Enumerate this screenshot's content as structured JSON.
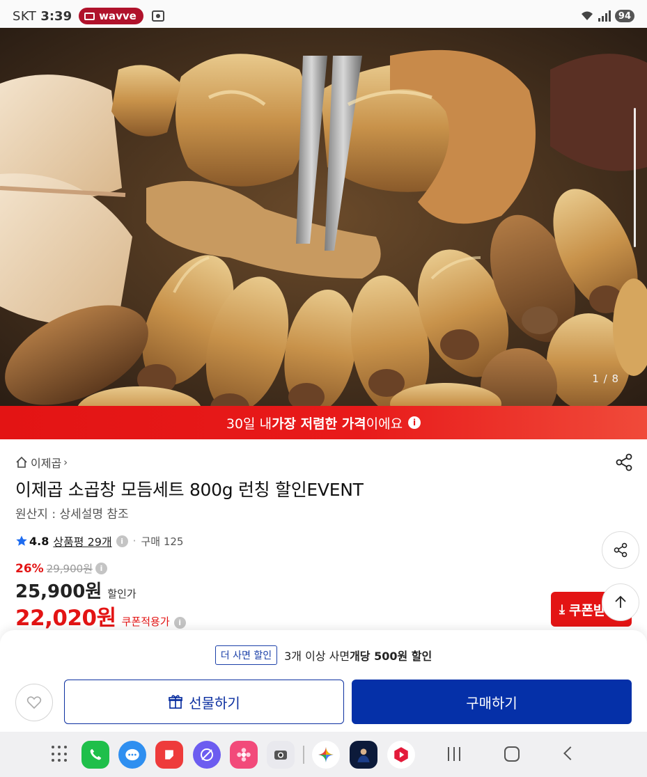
{
  "status_bar": {
    "carrier": "SKT",
    "time": "3:39",
    "media_app": "wavve",
    "battery": "94"
  },
  "hero": {
    "image_counter": "1 / 8"
  },
  "banner": {
    "text_prefix": "30일 내 ",
    "text_bold": "가장 저렴한 가격",
    "text_suffix": "이에요"
  },
  "product": {
    "breadcrumb": "이제곱",
    "title": "이제곱 소곱창 모듬세트 800g 런칭 할인EVENT",
    "origin": "원산지 : 상세설명 참조",
    "rating": "4.8",
    "reviews": "상품평 29개",
    "purchases": "구매 125",
    "discount_rate": "26%",
    "original_price": "29,900원",
    "sale_price": "25,900원",
    "sale_label": "할인가",
    "coupon_price": "22,020원",
    "coupon_label": "쿠폰적용가"
  },
  "coupon_button": {
    "label": "쿠폰받기"
  },
  "bottom_sheet": {
    "bulk_tag": "더 사면 할인",
    "bulk_prefix": "3개 이상 사면 ",
    "bulk_bold": "개당 500원 할인",
    "gift_label": "선물하기",
    "buy_label": "구매하기"
  },
  "colors": {
    "brand_red": "#e31414",
    "brand_blue": "#0530a8",
    "wavve": "#b0122b"
  },
  "icons": {
    "home": "home-icon",
    "share": "share-icon",
    "star": "star-icon",
    "info": "info-icon",
    "heart": "heart-icon",
    "gift": "gift-icon",
    "download": "download-icon",
    "arrow_up": "arrow-up-icon"
  }
}
